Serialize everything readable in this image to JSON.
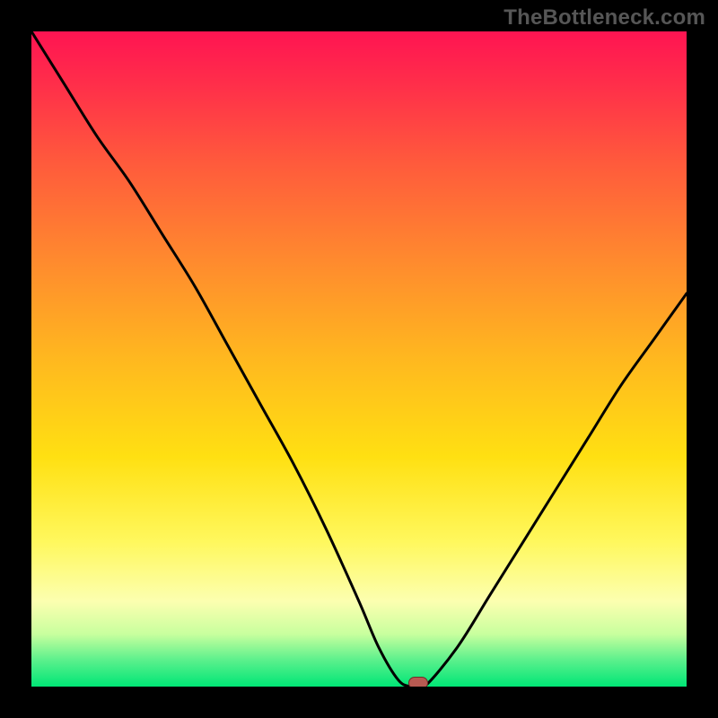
{
  "watermark": "TheBottleneck.com",
  "colors": {
    "frame_bg": "#000000",
    "watermark_text": "#565656",
    "curve_stroke": "#000000",
    "marker_fill": "#b85a52",
    "marker_border": "#6e2e28",
    "gradient_top": "#ff1452",
    "gradient_bottom": "#00e676"
  },
  "chart_data": {
    "type": "line",
    "title": "",
    "xlabel": "",
    "ylabel": "",
    "xlim": [
      0,
      100
    ],
    "ylim": [
      0,
      100
    ],
    "grid": false,
    "legend": false,
    "series": [
      {
        "name": "bottleneck-curve",
        "x": [
          0,
          5,
          10,
          15,
          20,
          25,
          30,
          35,
          40,
          45,
          50,
          53,
          56,
          58,
          60,
          65,
          70,
          75,
          80,
          85,
          90,
          95,
          100
        ],
        "y": [
          100,
          92,
          84,
          77,
          69,
          61,
          52,
          43,
          34,
          24,
          13,
          6,
          1,
          0,
          0,
          6,
          14,
          22,
          30,
          38,
          46,
          53,
          60
        ]
      }
    ],
    "marker": {
      "x": 59,
      "y": 0.5
    },
    "background_gradient_meaning": "bottleneck severity (red=high, green=optimal)"
  }
}
